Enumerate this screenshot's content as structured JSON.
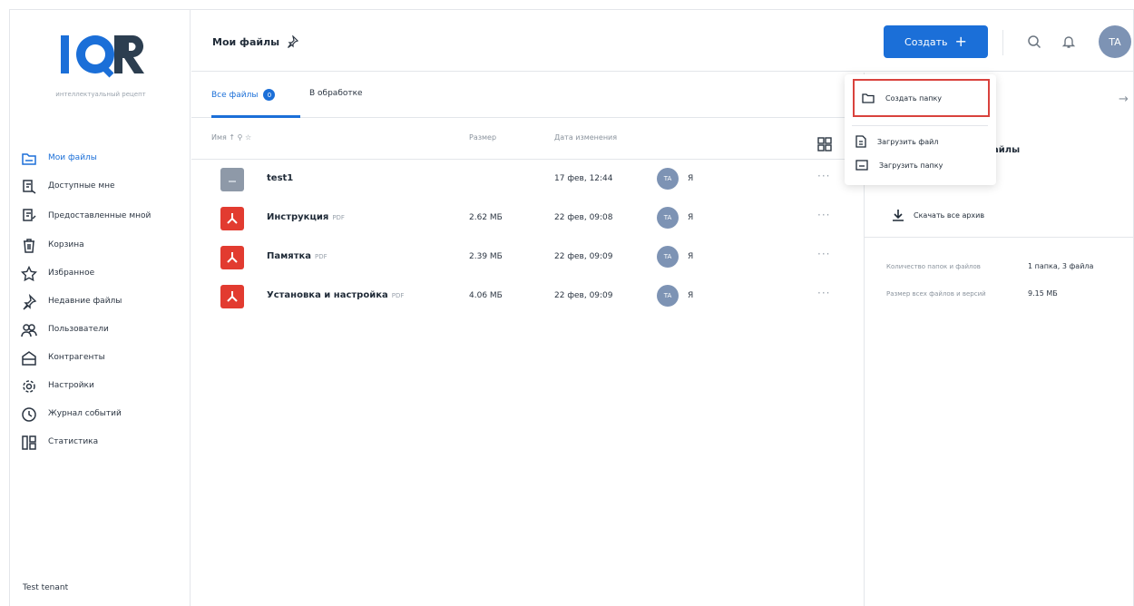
{
  "logo": {
    "text": "IQR",
    "subtitle": "интеллектуальный рецепт"
  },
  "sidebar": {
    "items": [
      {
        "label": "Мои файлы",
        "icon": "folder-icon",
        "active": true
      },
      {
        "label": "Доступные мне",
        "icon": "shared-with-me-icon",
        "active": false
      },
      {
        "label": "Предоставленные мной",
        "icon": "shared-by-me-icon",
        "active": false
      },
      {
        "label": "Корзина",
        "icon": "trash-icon",
        "active": false
      },
      {
        "label": "Избранное",
        "icon": "star-icon",
        "active": false
      },
      {
        "label": "Недавние файлы",
        "icon": "pin-icon",
        "active": false
      },
      {
        "label": "Пользователи",
        "icon": "users-icon",
        "active": false
      },
      {
        "label": "Контрагенты",
        "icon": "contractors-icon",
        "active": false
      },
      {
        "label": "Настройки",
        "icon": "gear-icon",
        "active": false
      },
      {
        "label": "Журнал событий",
        "icon": "clock-icon",
        "active": false
      },
      {
        "label": "Статистика",
        "icon": "stats-icon",
        "active": false
      }
    ],
    "tenant": "Test tenant"
  },
  "header": {
    "title": "Мои файлы",
    "create_label": "Создать",
    "avatar": "TA"
  },
  "tabs": [
    {
      "label": "Все файлы",
      "badge": "0",
      "active": true
    },
    {
      "label": "В обработке",
      "active": false
    }
  ],
  "table": {
    "columns": {
      "name": "Имя",
      "size": "Размер",
      "date": "Дата изменения"
    },
    "rows": [
      {
        "name": "test1",
        "ext": "",
        "type": "folder",
        "size": "",
        "date": "17 фев, 12:44",
        "avatar": "TA",
        "owner": "Я"
      },
      {
        "name": "Инструкция",
        "ext": "PDF",
        "type": "pdf",
        "size": "2.62 МБ",
        "date": "22 фев, 09:08",
        "avatar": "TA",
        "owner": "Я"
      },
      {
        "name": "Памятка",
        "ext": "PDF",
        "type": "pdf",
        "size": "2.39 МБ",
        "date": "22 фев, 09:09",
        "avatar": "TA",
        "owner": "Я"
      },
      {
        "name": "Установка и настройка",
        "ext": "PDF",
        "type": "pdf",
        "size": "4.06 МБ",
        "date": "22 фев, 09:09",
        "avatar": "TA",
        "owner": "Я"
      }
    ]
  },
  "dropdown": {
    "create_folder": "Создать папку",
    "upload_file": "Загрузить файл",
    "upload_folder": "Загрузить папку"
  },
  "right_panel": {
    "title": "айлы",
    "download_label": "Скачать все архив",
    "folders_files_label": "Количество папок и файлов",
    "folders_files_value": "1 папка, 3 файла",
    "size_label": "Размер всех файлов и версий",
    "size_value": "9.15 МБ"
  },
  "colors": {
    "accent": "#1b6fd8",
    "pdf": "#e23b30",
    "folder": "#8e99a8",
    "highlight": "#d9423d"
  }
}
